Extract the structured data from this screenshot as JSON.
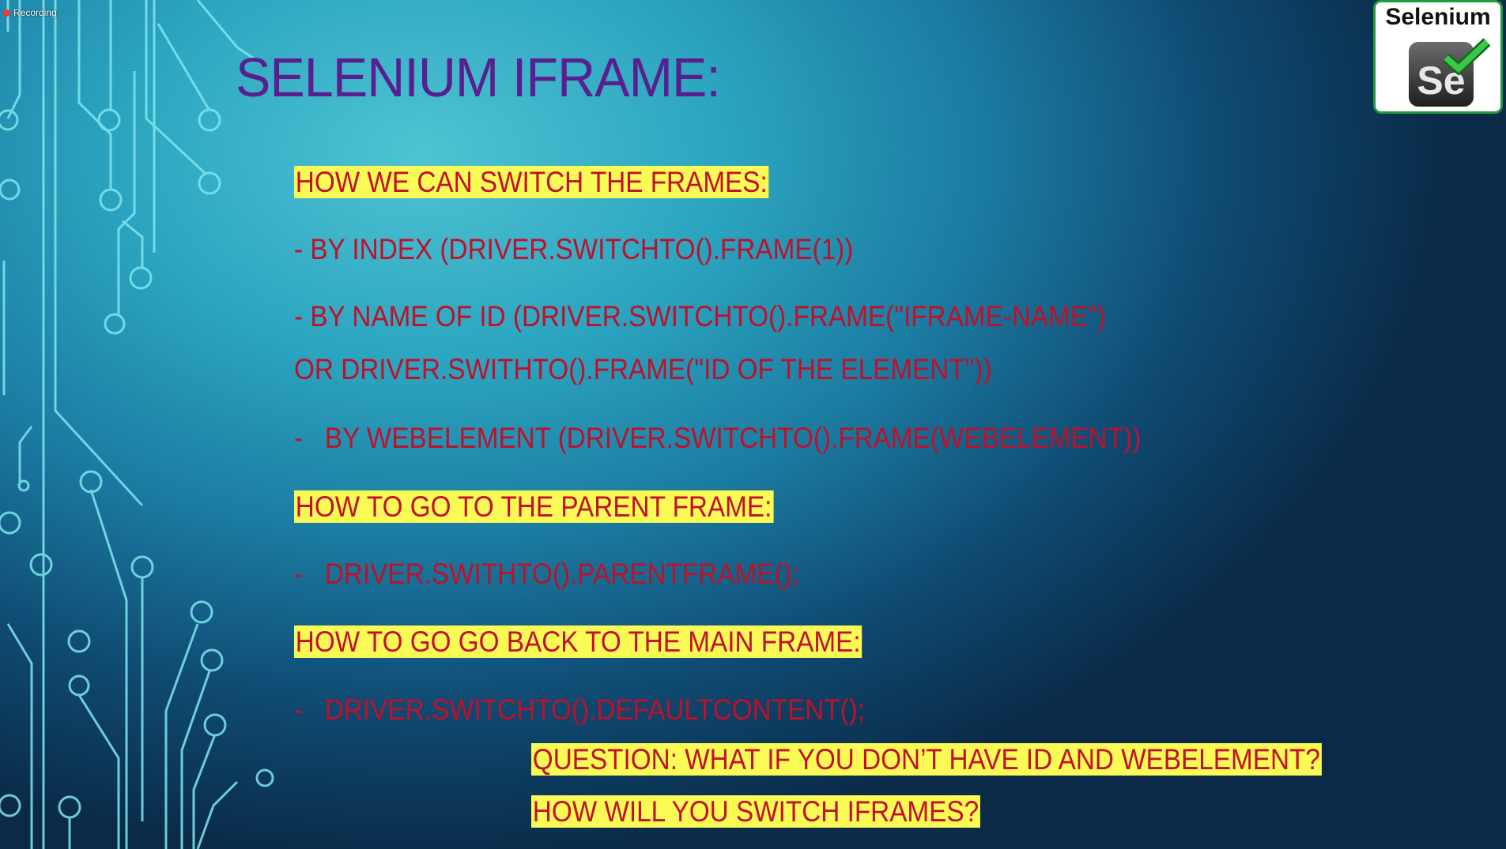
{
  "recording": {
    "label": "Recording",
    "icon": "record-dot-icon",
    "color": "#f23a3a"
  },
  "logo": {
    "text": "Selenium",
    "mark": "Se"
  },
  "slide": {
    "title": "SELENIUM IFRAME:",
    "lines": [
      {
        "text": "HOW WE CAN SWITCH THE FRAMES:",
        "highlight": true
      },
      {
        "text": "- BY INDEX (DRIVER.SWITCHTO().FRAME(1))",
        "highlight": false
      },
      {
        "text": "- BY NAME OF ID (DRIVER.SWITCHTO().FRAME(\"IFRAME-NAME\")",
        "highlight": false
      },
      {
        "text": "OR DRIVER.SWITHTO().FRAME(\"ID OF THE ELEMENT\"))",
        "highlight": false
      },
      {
        "text": "-   BY WEBELEMENT (DRIVER.SWITCHTO().FRAME(WEBELEMENT))",
        "highlight": false
      },
      {
        "text": "HOW TO GO TO THE PARENT FRAME:",
        "highlight": true
      },
      {
        "text": "-   DRIVER.SWITHTO().PARENTFRAME();",
        "highlight": false
      },
      {
        "text": "HOW TO GO GO BACK TO THE MAIN FRAME:",
        "highlight": true
      },
      {
        "text": "-   DRIVER.SWITCHTO().DEFAULTCONTENT();",
        "highlight": false
      }
    ],
    "question": [
      "QUESTION: WHAT IF YOU DON’T HAVE ID AND WEBELEMENT?",
      "HOW WILL YOU SWITCH IFRAMES?"
    ]
  },
  "colors": {
    "title": "#5a1f8f",
    "text": "#c0102a",
    "highlight": "#fbfb56"
  }
}
